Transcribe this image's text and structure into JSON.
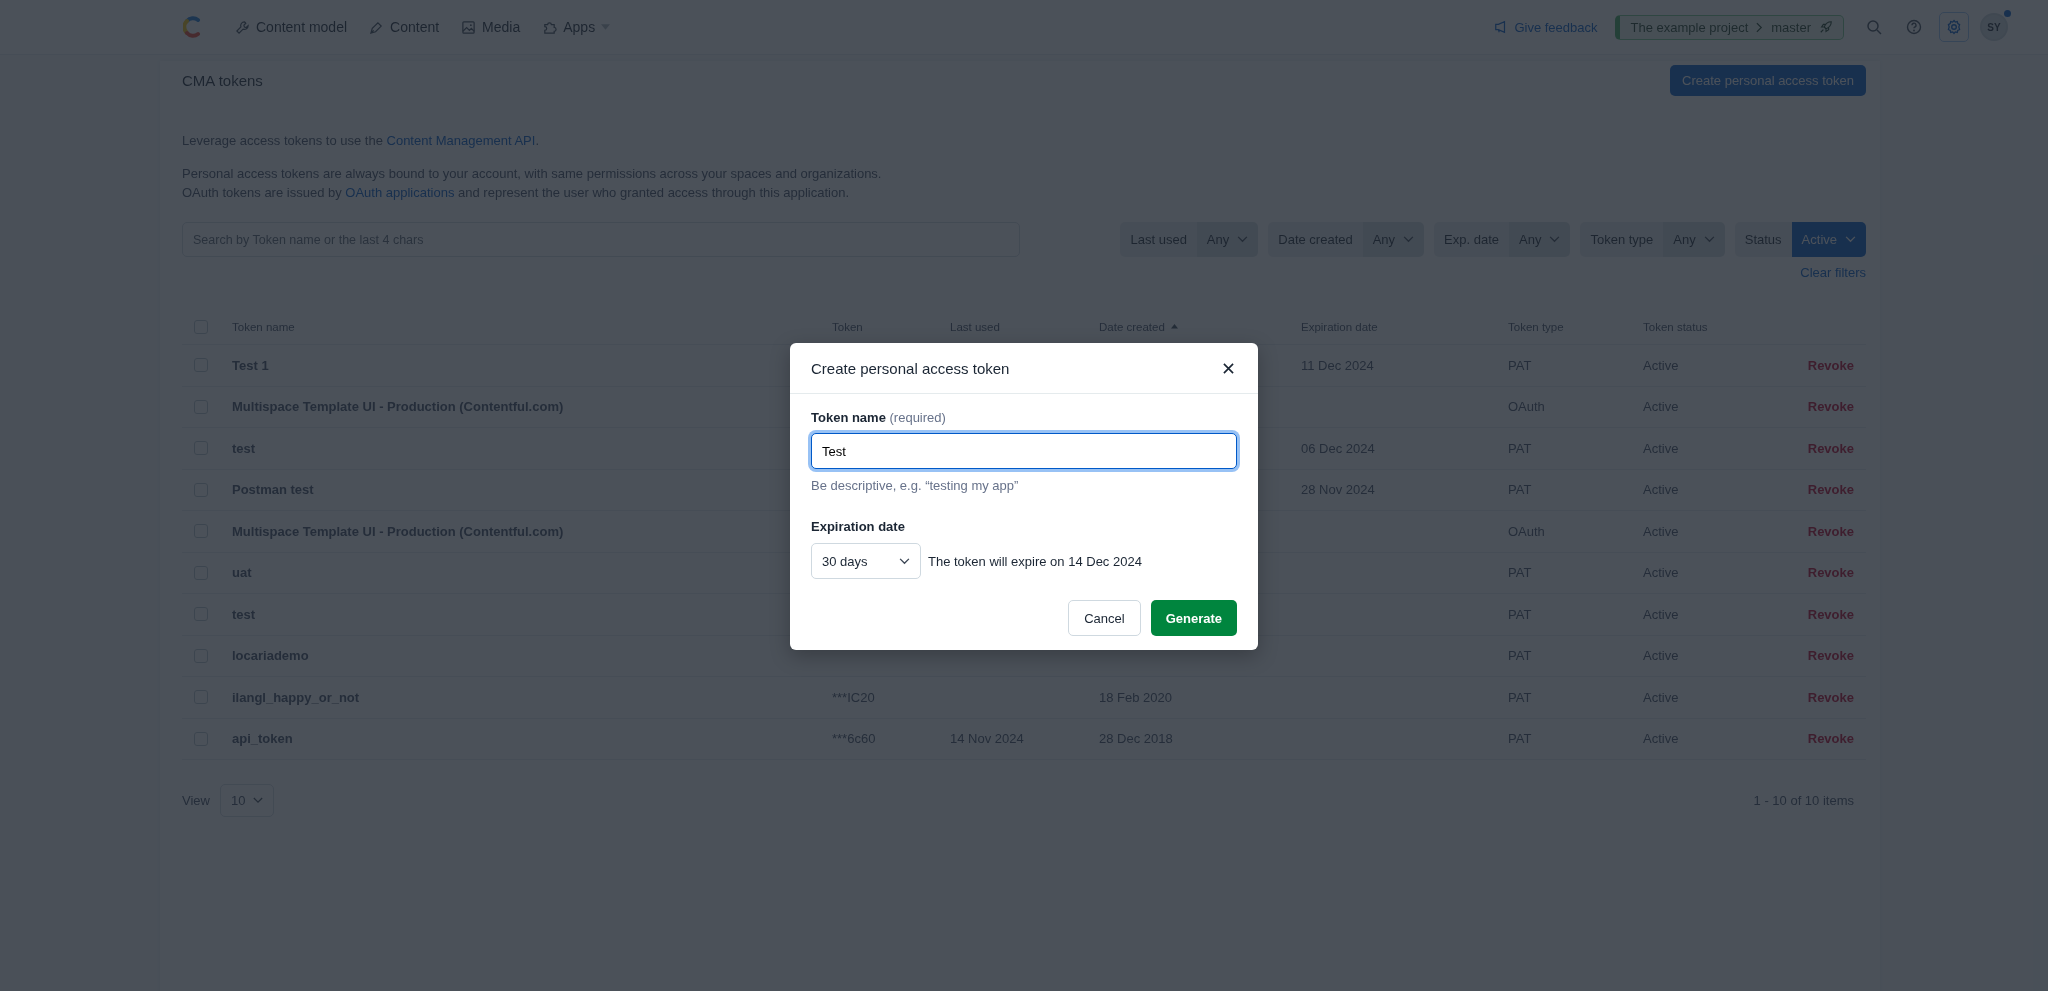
{
  "nav": {
    "items": [
      {
        "label": "Content model",
        "kind": "wrench",
        "has_caret": false
      },
      {
        "label": "Content",
        "kind": "pen",
        "has_caret": false
      },
      {
        "label": "Media",
        "kind": "image",
        "has_caret": false
      },
      {
        "label": "Apps",
        "kind": "puzzle",
        "has_caret": true
      }
    ],
    "feedback": "Give feedback",
    "project": "The example project",
    "environment": "master",
    "avatar": "SY",
    "notification": true
  },
  "page": {
    "title": "CMA tokens",
    "create_button": "Create personal access token",
    "intro": {
      "before": "Leverage access tokens to use the ",
      "link": "Content Management API",
      "after": "."
    },
    "line_1": "Personal access tokens are always bound to your account, with same permissions across your spaces and organizations.",
    "line_2": {
      "before": "OAuth tokens are issued by ",
      "link": "OAuth applications",
      "after": " and represent the user who granted access through this application."
    },
    "search": {
      "placeholder": "Search by Token name or the last 4 chars"
    },
    "filters": [
      {
        "label": "Last used",
        "value": "Any",
        "active": false
      },
      {
        "label": "Date created",
        "value": "Any",
        "active": false
      },
      {
        "label": "Exp. date",
        "value": "Any",
        "active": false
      },
      {
        "label": "Token type",
        "value": "Any",
        "active": false
      },
      {
        "label": "Status",
        "value": "Active",
        "active": true
      }
    ],
    "clear_filters": "Clear filters"
  },
  "table": {
    "select_all_checked": false,
    "columns": [
      {
        "label": "Token name",
        "sorted": false
      },
      {
        "label": "Token",
        "sorted": false
      },
      {
        "label": "Last used",
        "sorted": false
      },
      {
        "label": "Date created",
        "sorted": true
      },
      {
        "label": "Expiration date",
        "sorted": false
      },
      {
        "label": "Token type",
        "sorted": false
      },
      {
        "label": "Token status",
        "sorted": false
      }
    ],
    "rows": [
      {
        "checked": false,
        "name": "Test 1",
        "expires": "11 Dec 2024",
        "type": "PAT",
        "status": "Active",
        "action": "Revoke"
      },
      {
        "checked": false,
        "name": "Multispace Template UI - Production (Contentful.com)",
        "type": "OAuth",
        "status": "Active",
        "action": "Revoke"
      },
      {
        "checked": false,
        "name": "test",
        "expires": "06 Dec 2024",
        "type": "PAT",
        "status": "Active",
        "action": "Revoke"
      },
      {
        "checked": false,
        "name": "Postman test",
        "expires": "28 Nov 2024",
        "type": "PAT",
        "status": "Active",
        "action": "Revoke"
      },
      {
        "checked": false,
        "name": "Multispace Template UI - Production (Contentful.com)",
        "type": "OAuth",
        "status": "Active",
        "action": "Revoke"
      },
      {
        "checked": false,
        "name": "uat",
        "type": "PAT",
        "status": "Active",
        "action": "Revoke"
      },
      {
        "checked": false,
        "name": "test",
        "type": "PAT",
        "status": "Active",
        "action": "Revoke"
      },
      {
        "checked": false,
        "name": "locariademo",
        "type": "PAT",
        "status": "Active",
        "action": "Revoke"
      },
      {
        "checked": false,
        "name": "ilangl_happy_or_not",
        "token": "***IC20",
        "created": "18 Feb 2020",
        "type": "PAT",
        "status": "Active",
        "action": "Revoke"
      },
      {
        "checked": false,
        "name": "api_token",
        "token": "***6c60",
        "last_used": "14 Nov 2024",
        "created": "28 Dec 2018",
        "type": "PAT",
        "status": "Active",
        "action": "Revoke"
      }
    ]
  },
  "pagination": {
    "view_label": "View",
    "page_size": "10",
    "range": "1 - 10 of 10 items"
  },
  "modal": {
    "title": "Create personal access token",
    "name_label": "Token name",
    "name_note": "(required)",
    "name_value": "Test",
    "name_help": "Be descriptive, e.g. “testing my app”",
    "expiration_label": "Expiration date",
    "expiration_value": "30 days",
    "expiration_note": "The token will expire on 14 Dec 2024",
    "cancel": "Cancel",
    "generate": "Generate"
  }
}
